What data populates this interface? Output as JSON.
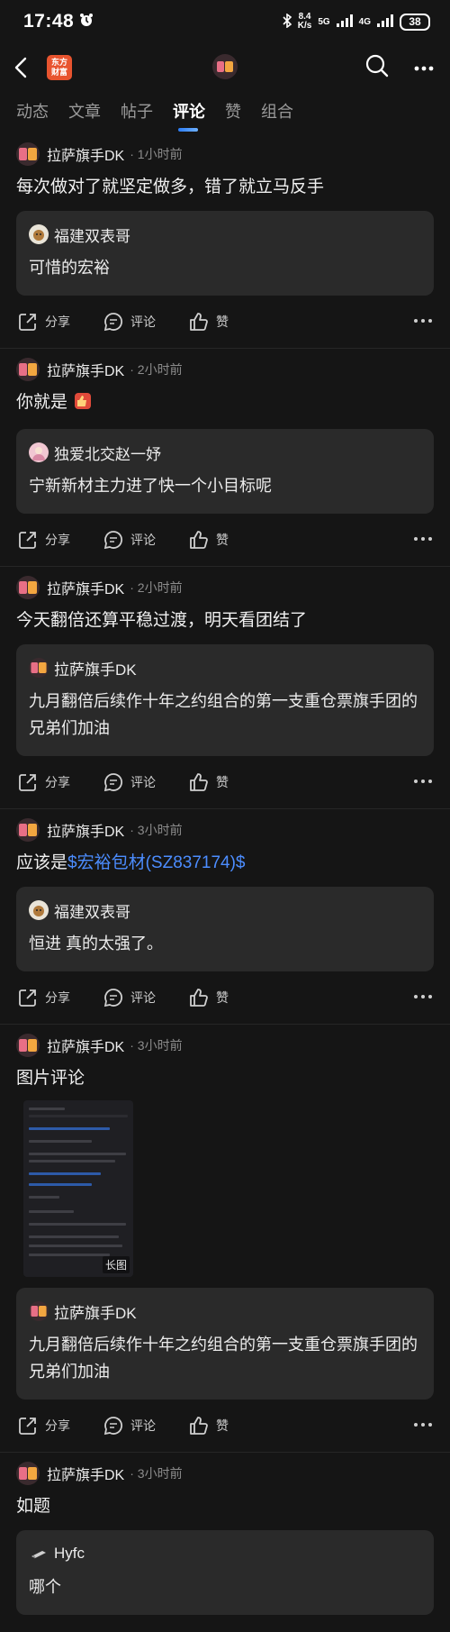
{
  "status_bar": {
    "time": "17:48",
    "speed_value": "8.4",
    "speed_unit": "K/s",
    "net1": "5G",
    "net2": "4G",
    "battery": "38"
  },
  "tabs": [
    {
      "label": "动态"
    },
    {
      "label": "文章"
    },
    {
      "label": "帖子"
    },
    {
      "label": "评论"
    },
    {
      "label": "赞"
    },
    {
      "label": "组合"
    }
  ],
  "app_logo": {
    "line1": "东方",
    "line2": "财富"
  },
  "actions": {
    "share": "分享",
    "comment": "评论",
    "like": "赞"
  },
  "posts": [
    {
      "author": "拉萨旗手DK",
      "time": "· 1小时前",
      "text": "每次做对了就坚定做多，错了就立马反手",
      "quote_author": "福建双表哥",
      "quote_text": "可惜的宏裕"
    },
    {
      "author": "拉萨旗手DK",
      "time": "· 2小时前",
      "text": "你就是",
      "quote_author": "独爱北交赵一妤",
      "quote_text": "宁新新材主力进了快一个小目标呢"
    },
    {
      "author": "拉萨旗手DK",
      "time": "· 2小时前",
      "text": "今天翻倍还算平稳过渡，明天看团结了",
      "quote_author": "拉萨旗手DK",
      "quote_text": "九月翻倍后续作十年之约组合的第一支重仓票旗手团的兄弟们加油"
    },
    {
      "author": "拉萨旗手DK",
      "time": "· 3小时前",
      "text_prefix": "应该是",
      "text_link": "$宏裕包材(SZ837174)$",
      "quote_author": "福建双表哥",
      "quote_text": "恒进 真的太强了。"
    },
    {
      "author": "拉萨旗手DK",
      "time": "· 3小时前",
      "text": "图片评论",
      "image_label": "长图",
      "quote_author": "拉萨旗手DK",
      "quote_text": "九月翻倍后续作十年之约组合的第一支重仓票旗手团的兄弟们加油"
    },
    {
      "author": "拉萨旗手DK",
      "time": "· 3小时前",
      "text": "如题",
      "quote_author": "Hyfc",
      "quote_text": "哪个"
    }
  ],
  "colors": {
    "background": "#151515",
    "card": "#2a2a2a",
    "link": "#4c8dff",
    "tab_underline": "#2b7cf5"
  }
}
